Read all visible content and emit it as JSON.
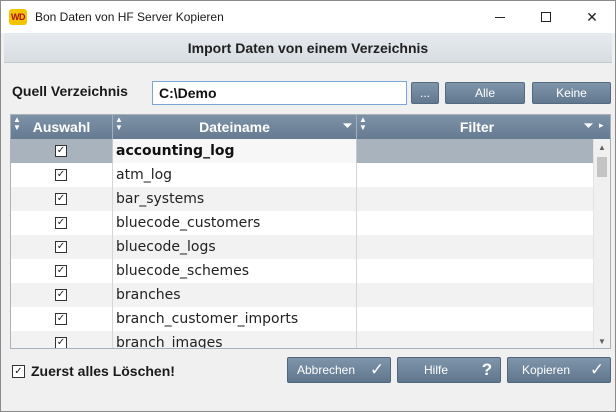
{
  "window": {
    "title": "Bon Daten von HF Server Kopieren",
    "app_icon_text": "WD"
  },
  "header": {
    "title": "Import Daten von einem Verzeichnis"
  },
  "source": {
    "label": "Quell Verzeichnis",
    "value": "C:\\Demo",
    "browse_label": "...",
    "all_label": "Alle",
    "none_label": "Keine"
  },
  "table": {
    "columns": [
      "Auswahl",
      "Dateiname",
      "Filter"
    ],
    "rows": [
      {
        "checked": true,
        "name": "accounting_log",
        "filter": ""
      },
      {
        "checked": true,
        "name": "atm_log",
        "filter": ""
      },
      {
        "checked": true,
        "name": "bar_systems",
        "filter": ""
      },
      {
        "checked": true,
        "name": "bluecode_customers",
        "filter": ""
      },
      {
        "checked": true,
        "name": "bluecode_logs",
        "filter": ""
      },
      {
        "checked": true,
        "name": "bluecode_schemes",
        "filter": ""
      },
      {
        "checked": true,
        "name": "branches",
        "filter": ""
      },
      {
        "checked": true,
        "name": "branch_customer_imports",
        "filter": ""
      },
      {
        "checked": true,
        "name": "branch_images",
        "filter": ""
      }
    ]
  },
  "footer": {
    "delete_first_label": "Zuerst alles Löschen!",
    "delete_first_checked": true,
    "cancel_label": "Abbrechen",
    "help_label": "Hilfe",
    "copy_label": "Kopieren"
  },
  "colors": {
    "button_bg": "#6d8399",
    "selected_row": "#a9b3bd"
  }
}
